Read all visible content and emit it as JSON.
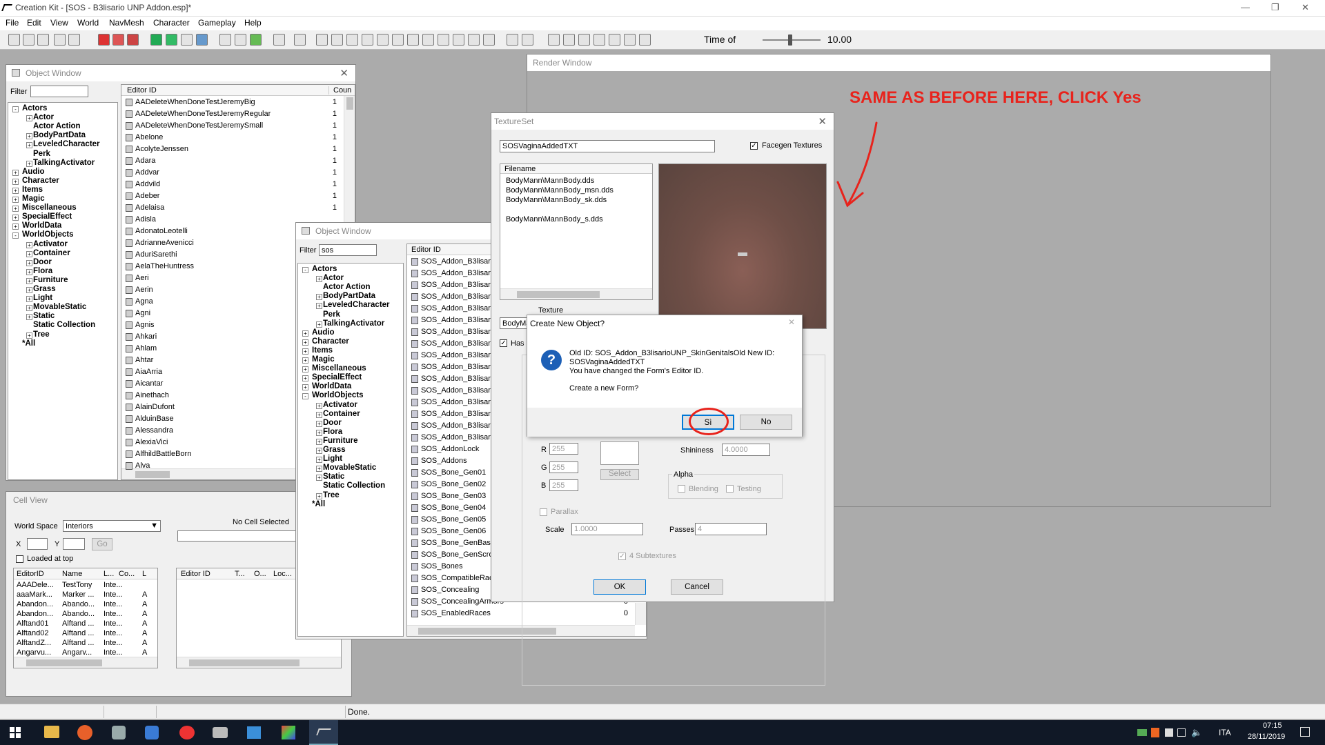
{
  "app": {
    "title": "Creation Kit - [SOS - B3lisario UNP Addon.esp]*"
  },
  "menu": [
    "File",
    "Edit",
    "View",
    "World",
    "NavMesh",
    "Character",
    "Gameplay",
    "Help"
  ],
  "toolbar": {
    "time_label": "Time of",
    "time_value": "10.00"
  },
  "object_window_1": {
    "title": "Object Window",
    "filter_label": "Filter",
    "filter_value": "",
    "col_editor_id": "Editor ID",
    "col_count": "Coun",
    "tree": [
      {
        "label": "Actors",
        "expander": "-",
        "indent": 0
      },
      {
        "label": "Actor",
        "expander": "+",
        "indent": 1
      },
      {
        "label": "Actor Action",
        "expander": "",
        "indent": 1
      },
      {
        "label": "BodyPartData",
        "expander": "+",
        "indent": 1
      },
      {
        "label": "LeveledCharacter",
        "expander": "+",
        "indent": 1
      },
      {
        "label": "Perk",
        "expander": "",
        "indent": 1
      },
      {
        "label": "TalkingActivator",
        "expander": "+",
        "indent": 1
      },
      {
        "label": "Audio",
        "expander": "+",
        "indent": 0
      },
      {
        "label": "Character",
        "expander": "+",
        "indent": 0
      },
      {
        "label": "Items",
        "expander": "+",
        "indent": 0
      },
      {
        "label": "Magic",
        "expander": "+",
        "indent": 0
      },
      {
        "label": "Miscellaneous",
        "expander": "+",
        "indent": 0
      },
      {
        "label": "SpecialEffect",
        "expander": "+",
        "indent": 0
      },
      {
        "label": "WorldData",
        "expander": "+",
        "indent": 0
      },
      {
        "label": "WorldObjects",
        "expander": "-",
        "indent": 0
      },
      {
        "label": "Activator",
        "expander": "+",
        "indent": 1
      },
      {
        "label": "Container",
        "expander": "+",
        "indent": 1
      },
      {
        "label": "Door",
        "expander": "+",
        "indent": 1
      },
      {
        "label": "Flora",
        "expander": "+",
        "indent": 1
      },
      {
        "label": "Furniture",
        "expander": "+",
        "indent": 1
      },
      {
        "label": "Grass",
        "expander": "+",
        "indent": 1
      },
      {
        "label": "Light",
        "expander": "+",
        "indent": 1
      },
      {
        "label": "MovableStatic",
        "expander": "+",
        "indent": 1
      },
      {
        "label": "Static",
        "expander": "+",
        "indent": 1
      },
      {
        "label": "Static Collection",
        "expander": "",
        "indent": 1
      },
      {
        "label": "Tree",
        "expander": "+",
        "indent": 1
      },
      {
        "label": "*All",
        "expander": "",
        "indent": 0
      }
    ],
    "rows": [
      {
        "id": "AADeleteWhenDoneTestJeremyBig",
        "count": "1"
      },
      {
        "id": "AADeleteWhenDoneTestJeremyRegular",
        "count": "1"
      },
      {
        "id": "AADeleteWhenDoneTestJeremySmall",
        "count": "1"
      },
      {
        "id": "Abelone",
        "count": "1"
      },
      {
        "id": "AcolyteJenssen",
        "count": "1"
      },
      {
        "id": "Adara",
        "count": "1"
      },
      {
        "id": "Addvar",
        "count": "1"
      },
      {
        "id": "Addvild",
        "count": "1"
      },
      {
        "id": "Adeber",
        "count": "1"
      },
      {
        "id": "Adelaisa",
        "count": "1"
      },
      {
        "id": "Adisla",
        "count": ""
      },
      {
        "id": "AdonatoLeotelli",
        "count": ""
      },
      {
        "id": "AdrianneAvenicci",
        "count": ""
      },
      {
        "id": "AduriSarethi",
        "count": ""
      },
      {
        "id": "AelaTheHuntress",
        "count": ""
      },
      {
        "id": "Aeri",
        "count": ""
      },
      {
        "id": "Aerin",
        "count": ""
      },
      {
        "id": "Agna",
        "count": ""
      },
      {
        "id": "Agni",
        "count": ""
      },
      {
        "id": "Agnis",
        "count": ""
      },
      {
        "id": "Ahkari",
        "count": ""
      },
      {
        "id": "Ahlam",
        "count": ""
      },
      {
        "id": "Ahtar",
        "count": ""
      },
      {
        "id": "AiaArria",
        "count": ""
      },
      {
        "id": "Aicantar",
        "count": ""
      },
      {
        "id": "Ainethach",
        "count": ""
      },
      {
        "id": "AlainDufont",
        "count": ""
      },
      {
        "id": "AlduinBase",
        "count": ""
      },
      {
        "id": "Alessandra",
        "count": ""
      },
      {
        "id": "AlexiaVici",
        "count": ""
      },
      {
        "id": "AlfhildBattleBorn",
        "count": ""
      },
      {
        "id": "Alva",
        "count": ""
      }
    ]
  },
  "object_window_2": {
    "title": "Object Window",
    "filter_label": "Filter",
    "filter_value": "sos",
    "col_editor_id": "Editor ID",
    "rows": [
      {
        "id": "SOS_Addon_B3lisari",
        "count": ""
      },
      {
        "id": "SOS_Addon_B3lisari",
        "count": ""
      },
      {
        "id": "SOS_Addon_B3lisari",
        "count": ""
      },
      {
        "id": "SOS_Addon_B3lisari",
        "count": ""
      },
      {
        "id": "SOS_Addon_B3lisari",
        "count": ""
      },
      {
        "id": "SOS_Addon_B3lisari",
        "count": ""
      },
      {
        "id": "SOS_Addon_B3lisari",
        "count": ""
      },
      {
        "id": "SOS_Addon_B3lisari",
        "count": ""
      },
      {
        "id": "SOS_Addon_B3lisari",
        "count": ""
      },
      {
        "id": "SOS_Addon_B3lisari",
        "count": ""
      },
      {
        "id": "SOS_Addon_B3lisari",
        "count": ""
      },
      {
        "id": "SOS_Addon_B3lisari",
        "count": ""
      },
      {
        "id": "SOS_Addon_B3lisari",
        "count": ""
      },
      {
        "id": "SOS_Addon_B3lisari",
        "count": ""
      },
      {
        "id": "SOS_Addon_B3lisari",
        "count": ""
      },
      {
        "id": "SOS_Addon_B3lisari",
        "count": ""
      },
      {
        "id": "SOS_AddonLock",
        "count": ""
      },
      {
        "id": "SOS_Addons",
        "count": ""
      },
      {
        "id": "SOS_Bone_Gen01",
        "count": ""
      },
      {
        "id": "SOS_Bone_Gen02",
        "count": ""
      },
      {
        "id": "SOS_Bone_Gen03",
        "count": ""
      },
      {
        "id": "SOS_Bone_Gen04",
        "count": ""
      },
      {
        "id": "SOS_Bone_Gen05",
        "count": ""
      },
      {
        "id": "SOS_Bone_Gen06",
        "count": ""
      },
      {
        "id": "SOS_Bone_GenBase",
        "count": ""
      },
      {
        "id": "SOS_Bone_GenScro",
        "count": ""
      },
      {
        "id": "SOS_Bones",
        "count": ""
      },
      {
        "id": "SOS_CompatibleRac",
        "count": ""
      },
      {
        "id": "SOS_Concealing",
        "count": "0"
      },
      {
        "id": "SOS_ConcealingArmors",
        "count": "0"
      },
      {
        "id": "SOS_EnabledRaces",
        "count": "0"
      }
    ]
  },
  "cell_view": {
    "title": "Cell View",
    "world_space_label": "World Space",
    "world_space_value": "Interiors",
    "no_cell": "No Cell Selected",
    "x_label": "X",
    "y_label": "Y",
    "go": "Go",
    "loaded_at_top": "Loaded at top",
    "left_cols": [
      "EditorID",
      "Name",
      "L...",
      "Co...",
      "L"
    ],
    "left_rows": [
      [
        "AAADele...",
        "TestTony",
        "Inte...",
        ""
      ],
      [
        "aaaMark...",
        "Marker ...",
        "Inte...",
        "A"
      ],
      [
        "Abandon...",
        "Abando...",
        "Inte...",
        "A"
      ],
      [
        "Abandon...",
        "Abando...",
        "Inte...",
        "A"
      ],
      [
        "Alftand01",
        "Alftand ...",
        "Inte...",
        "A"
      ],
      [
        "Alftand02",
        "Alftand ...",
        "Inte...",
        "A"
      ],
      [
        "AlftandZ...",
        "Alftand ...",
        "Inte...",
        "A"
      ],
      [
        "Angarvu...",
        "Angarv...",
        "Inte...",
        "A"
      ]
    ],
    "right_cols": [
      "Editor ID",
      "T...",
      "O...",
      "Loc..."
    ]
  },
  "render_window": {
    "title": "Render Window"
  },
  "annotation": {
    "text": "SAME AS BEFORE HERE, CLICK  Yes",
    "color": "#e8231c"
  },
  "textureset": {
    "title": "TextureSet",
    "editor_id": "SOSVaginaAddedTXT",
    "facegen_label": "Facegen Textures",
    "filename_header": "Filename",
    "files": [
      "BodyMann\\MannBody.dds",
      "BodyMann\\MannBody_msn.dds",
      "BodyMann\\MannBody_sk.dds",
      "",
      "BodyMann\\MannBody_s.dds"
    ],
    "texture_label": "Texture",
    "texture_value": "BodyMa",
    "has_label": "Has",
    "r_label": "R",
    "g_label": "G",
    "b_label": "B",
    "r": "255",
    "g": "255",
    "b": "255",
    "select": "Select",
    "shininess_label": "Shininess",
    "shininess": "4.0000",
    "alpha_label": "Alpha",
    "blending": "Blending",
    "testing": "Testing",
    "parallax": "Parallax",
    "scale_label": "Scale",
    "scale": "1.0000",
    "passes_label": "Passes",
    "passes": "4",
    "subtextures": "4 Subtextures",
    "ok": "OK",
    "cancel": "Cancel"
  },
  "dialog": {
    "title": "Create New Object?",
    "line1": "Old ID: SOS_Addon_B3lisarioUNP_SkinGenitalsOld New ID:",
    "line2": "SOSVaginaAddedTXT",
    "line3": "You have changed the Form's Editor ID.",
    "line4": "Create a new Form?",
    "yes": "Sì",
    "no": "No"
  },
  "status": {
    "text": "Done."
  },
  "taskbar": {
    "lang": "ITA",
    "time": "07:15",
    "date": "28/11/2019"
  }
}
